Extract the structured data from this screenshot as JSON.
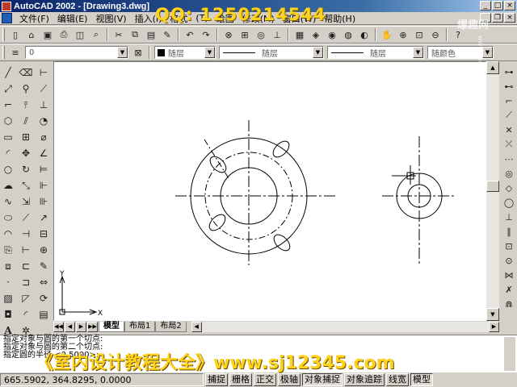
{
  "window": {
    "title": "AutoCAD 2002 - [Drawing3.dwg]"
  },
  "overlay": {
    "qq_text": "QQ: 1250214544",
    "promo_text": "《室内设计教程大全》www.sj12345.com",
    "watermark_top": "爆趣网",
    "watermark_side": "www.baoqu.net"
  },
  "menu": {
    "items": [
      "文件(F)",
      "编辑(E)",
      "视图(V)",
      "插入(I)",
      "格式",
      "(T)",
      "绘图",
      "修改(M)",
      "窗口(W)",
      "帮助(H)"
    ]
  },
  "layers_toolbar": {
    "layer_value": "0",
    "color_value": "随层",
    "linetype_value": "随层",
    "lineweight_value": "随层",
    "plotstyle_value": "随颜色"
  },
  "icons": {
    "file_toolbar": [
      "new-icon",
      "open-icon",
      "save-icon",
      "print-icon",
      "preview-icon",
      "cut-icon",
      "copy-icon",
      "paste-icon",
      "matchprop-icon",
      "undo-icon",
      "redo-icon"
    ],
    "draw_toolbar": [
      "line-icon",
      "xline-icon",
      "pline-icon",
      "polygon-icon",
      "rectang-icon",
      "arc-icon",
      "circle-icon",
      "spline-icon",
      "ellipse-icon",
      "insert-icon",
      "block-icon",
      "point-icon",
      "hatch-icon",
      "region-icon",
      "mtext-icon"
    ],
    "modify_toolbar": [
      "erase-icon",
      "copy-obj-icon",
      "mirror-icon",
      "offset-icon",
      "array-icon",
      "move-icon",
      "rotate-icon",
      "scale-icon",
      "stretch-icon",
      "lengthen-icon",
      "trim-icon",
      "extend-icon",
      "break-icon",
      "chamfer-icon",
      "fillet-icon",
      "explode-icon"
    ]
  },
  "tabs": {
    "model": "模型",
    "layout1": "布局1",
    "layout2": "布局2"
  },
  "ucs": {
    "x_label": "X",
    "y_label": "Y"
  },
  "command": {
    "lines": [
      "指定对象与圆的第一个切点:",
      "指定对象与圆的第二个切点:",
      "指定圆的半径 <0.5000>:"
    ]
  },
  "status": {
    "coordinates": "665.5902, 364.8295, 0.0000",
    "buttons": [
      {
        "label": "捕捉",
        "on": false
      },
      {
        "label": "栅格",
        "on": false
      },
      {
        "label": "正交",
        "on": false
      },
      {
        "label": "极轴",
        "on": false
      },
      {
        "label": "对象捕捉",
        "on": true
      },
      {
        "label": "对象追踪",
        "on": false
      },
      {
        "label": "线宽",
        "on": false
      },
      {
        "label": "模型",
        "on": true
      }
    ]
  }
}
